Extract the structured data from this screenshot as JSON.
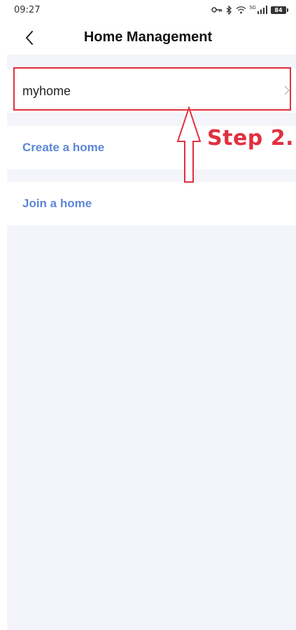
{
  "status_bar": {
    "time": "09:27",
    "network_label": "5G",
    "battery": "84"
  },
  "header": {
    "title": "Home Management"
  },
  "homes": [
    {
      "label": "myhome"
    }
  ],
  "actions": {
    "create_label": "Create a home",
    "join_label": "Join a home"
  },
  "annotation": {
    "step_text": "Step 2.",
    "color": "#e0303f"
  },
  "colors": {
    "link": "#5b87d6",
    "background": "#f4f5fa"
  }
}
